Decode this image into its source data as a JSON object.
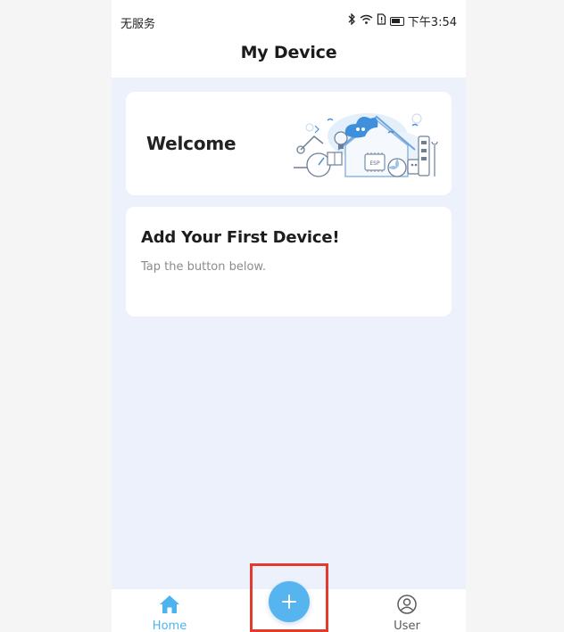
{
  "status_bar": {
    "carrier": "无服务",
    "time": "下午3:54",
    "icons": [
      "bluetooth-icon",
      "wifi-icon",
      "sim-icon",
      "battery-icon"
    ]
  },
  "header": {
    "title": "My Device"
  },
  "welcome_card": {
    "title": "Welcome",
    "illustration": {
      "label": "ESP",
      "icon": "smart-home-illustration"
    }
  },
  "add_device_card": {
    "title": "Add Your First Device!",
    "subtitle": "Tap the button below."
  },
  "bottom_nav": {
    "home": {
      "label": "Home",
      "icon": "home-icon",
      "active": true
    },
    "add": {
      "icon": "plus-icon"
    },
    "user": {
      "label": "User",
      "icon": "user-icon",
      "active": false
    }
  },
  "colors": {
    "accent": "#4db3f0",
    "fab": "#56b4ef",
    "background": "#edf1fb",
    "highlight_box": "#e23b2e"
  }
}
